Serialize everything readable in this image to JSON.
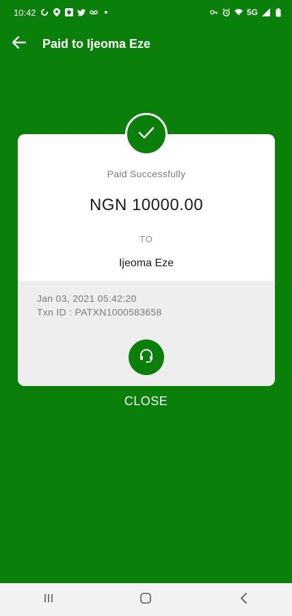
{
  "status_bar": {
    "time": "10:42",
    "network": "5G",
    "left_icons": [
      "sync-icon",
      "location-icon",
      "app-icon",
      "twitter-icon",
      "voicemail-icon",
      "dot-icon"
    ],
    "right_icons": [
      "vpn-key-icon",
      "alarm-icon",
      "wifi-icon",
      "signal-icon",
      "battery-icon"
    ]
  },
  "app_bar": {
    "title": "Paid to Ijeoma Eze",
    "back_icon": "arrow-left-icon"
  },
  "receipt": {
    "status_label": "Paid Successfully",
    "amount": "NGN 10000.00",
    "to_label": "TO",
    "payee": "Ijeoma Eze",
    "date": "Jan 03, 2021 05:42:20",
    "txn_id": "Txn ID : PATXN1000583658",
    "success_icon": "checkmark-icon",
    "support_icon": "headset-icon"
  },
  "actions": {
    "close_label": "CLOSE"
  },
  "nav_bar": {
    "recents_icon": "recents-icon",
    "home_icon": "home-icon",
    "back_icon": "back-icon"
  },
  "colors": {
    "brand_green": "#0a7f0a",
    "card_bg": "#ffffff",
    "card_footer_bg": "#eeeeee",
    "nav_bg": "#f2f2f2"
  }
}
